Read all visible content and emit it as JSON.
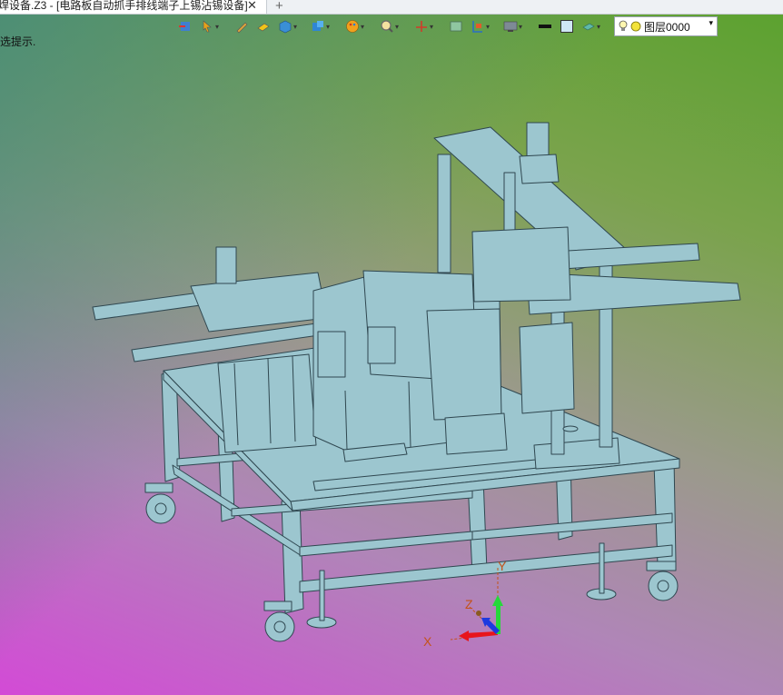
{
  "tab": {
    "title": "焊设备.Z3 - [电路板自动抓手排线端子上锡沾锡设备]",
    "close_glyph": "✕",
    "new_glyph": "+"
  },
  "toolbar": {
    "icons": [
      "import-icon",
      "cursor-icon",
      "pen-icon",
      "shape-icon",
      "cube-icon",
      "box-icon",
      "palette-icon",
      "zoom-icon",
      "axis-icon",
      "screen-icon",
      "align-icon",
      "display-icon",
      "line-color-swatch",
      "fill-color-swatch",
      "material-icon"
    ],
    "layer_label": "图层0000",
    "layer_dropdown_glyph": "▾"
  },
  "hint_text": "选提示.",
  "triad": {
    "x_label": "X",
    "y_label": "Y",
    "z_label": "Z"
  },
  "colors": {
    "model_fill": "#9cc6cf",
    "model_stroke": "#2f4750",
    "axis_x": "#e8151b",
    "axis_y": "#25d93a",
    "axis_z": "#1d3ae0",
    "axis_label": "#c4521a"
  }
}
